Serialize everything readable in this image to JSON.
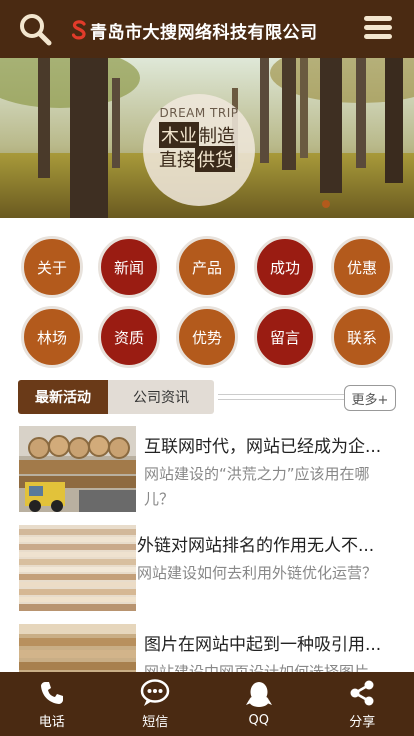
{
  "header": {
    "title": "青岛市大搜网络科技有限公司",
    "search_icon": "search-icon",
    "menu_icon": "hamburger-menu-icon"
  },
  "banner": {
    "en": "DREAM TRIP",
    "line1_dark": "木业",
    "line1_light": "制造",
    "line2_light": "直接",
    "line2_dark": "供货"
  },
  "nav": {
    "row1": [
      "关于",
      "新闻",
      "产品",
      "成功",
      "优惠"
    ],
    "row2": [
      "林场",
      "资质",
      "优势",
      "留言",
      "联系"
    ]
  },
  "tabs": {
    "active": "最新活动",
    "other": "公司资讯",
    "more": "更多+"
  },
  "news": [
    {
      "title": "互联网时代，网站已经成为企...",
      "desc": "网站建设的“洪荒之力”应该用在哪儿？"
    },
    {
      "title": "外链对网站排名的作用无人不...",
      "desc": "网站建设如何去利用外链优化运营？"
    },
    {
      "title": "图片在网站中起到一种吸引用...",
      "desc": "网站建设中网页设计如何选择图片"
    }
  ],
  "bottom": [
    {
      "label": "电话",
      "icon": "phone-icon"
    },
    {
      "label": "短信",
      "icon": "chat-bubble-icon"
    },
    {
      "label": "QQ",
      "icon": "qq-penguin-icon"
    },
    {
      "label": "分享",
      "icon": "share-icon"
    }
  ],
  "colors": {
    "brand_brown": "#4a2a12",
    "nav_orange": "#b35a1c",
    "nav_red": "#9a1c12"
  }
}
